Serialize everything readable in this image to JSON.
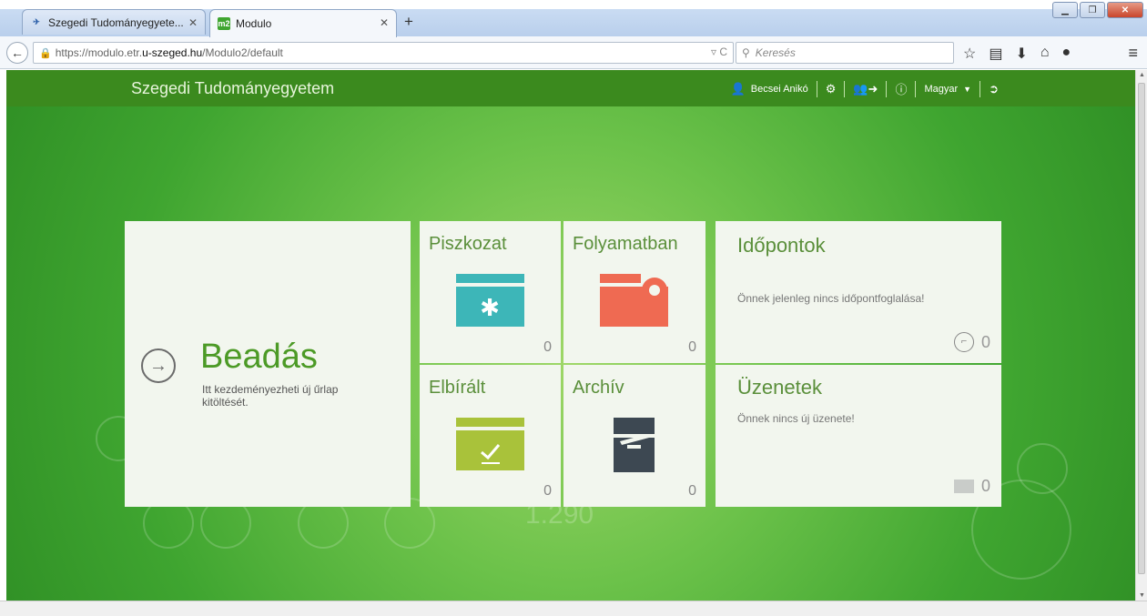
{
  "browser": {
    "tabs": [
      {
        "label": "Szegedi Tudományegyete...",
        "active": false
      },
      {
        "label": "Modulo",
        "favicon": "m2",
        "active": true
      }
    ],
    "url": {
      "prefix": "https://modulo.etr.",
      "domain": "u-szeged.hu",
      "path": "/Modulo2/default"
    },
    "search_placeholder": "Keresés"
  },
  "header": {
    "brand": "Szegedi Tudományegyetem",
    "user": "Becsei Anikó",
    "language": "Magyar"
  },
  "tiles": {
    "submit": {
      "title": "Beadás",
      "description": "Itt kezdeményezheti új űrlap kitöltését."
    },
    "draft": {
      "title": "Piszkozat",
      "count": "0"
    },
    "in_progress": {
      "title": "Folyamatban",
      "count": "0"
    },
    "judged": {
      "title": "Elbírált",
      "count": "0"
    },
    "archive": {
      "title": "Archív",
      "count": "0"
    },
    "appointments": {
      "title": "Időpontok",
      "message": "Önnek jelenleg nincs időpontfoglalása!",
      "count": "0"
    },
    "messages": {
      "title": "Üzenetek",
      "message": "Önnek nincs új üzenete!",
      "count": "0"
    }
  },
  "background": {
    "number": "1.290"
  },
  "colors": {
    "header": "#3b8a1e",
    "draft_icon": "#3db6b8",
    "progress_icon": "#ef6a52",
    "judged_icon": "#a9c23a",
    "archive_icon": "#3d4852"
  }
}
